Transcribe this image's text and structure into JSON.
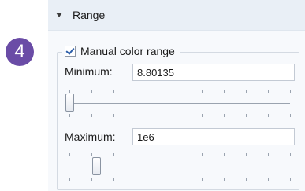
{
  "step": {
    "number": "4",
    "color": "#6a4ca6"
  },
  "section": {
    "title": "Range",
    "collapse_icon": "triangle-down-icon"
  },
  "manual_range": {
    "label": "Manual color range",
    "checked": true
  },
  "minimum": {
    "label": "Minimum:",
    "value": "8.80135",
    "slider_position": 0.0
  },
  "maximum": {
    "label": "Maximum:",
    "value": "1e6",
    "slider_position": 0.12
  },
  "colors": {
    "accent": "#6a4ca6",
    "header_bg": "#e9eff6",
    "panel_bg": "#f7f9fc"
  }
}
